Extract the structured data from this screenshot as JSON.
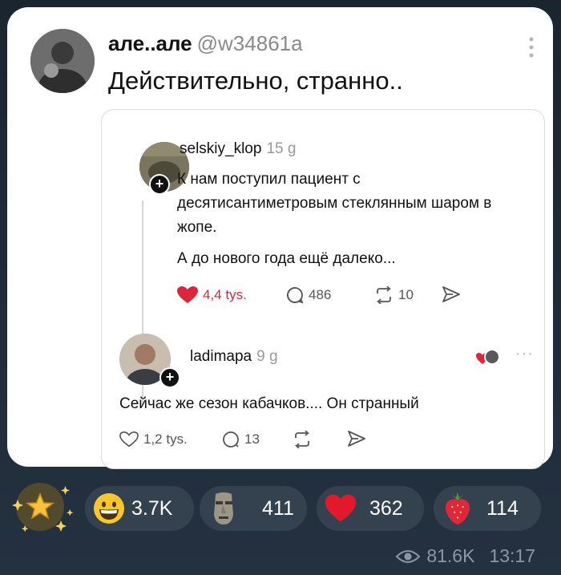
{
  "post": {
    "author_name": "але..але",
    "author_handle": "@w34861a",
    "text": "Действительно, странно.."
  },
  "quoted": {
    "username": "selskiy_klop",
    "time": "15 g",
    "text": "К нам поступил пациент с десятисантиметровым стеклянным шаром в жопе.",
    "text2": "А до нового года ещё далеко...",
    "likes": "4,4 tys.",
    "comments": "486",
    "reposts": "10"
  },
  "reply": {
    "username": "ladimapa",
    "time": "9 g",
    "text": "Сейчас же сезон кабачков.... Он странный",
    "likes": "1,2 tys.",
    "comments": "13"
  },
  "reactions": [
    {
      "icon": "grinning-face-icon",
      "count": "3.7K"
    },
    {
      "icon": "moai-icon",
      "count": "411"
    },
    {
      "icon": "red-heart-icon",
      "count": "362"
    },
    {
      "icon": "strawberry-icon",
      "count": "114"
    }
  ],
  "meta": {
    "views": "81.6K",
    "time": "13:17"
  },
  "colors": {
    "background": "#1f2a36",
    "pill": "#34414f",
    "like_red": "#e0243b",
    "meta_text": "#8a98a6"
  }
}
